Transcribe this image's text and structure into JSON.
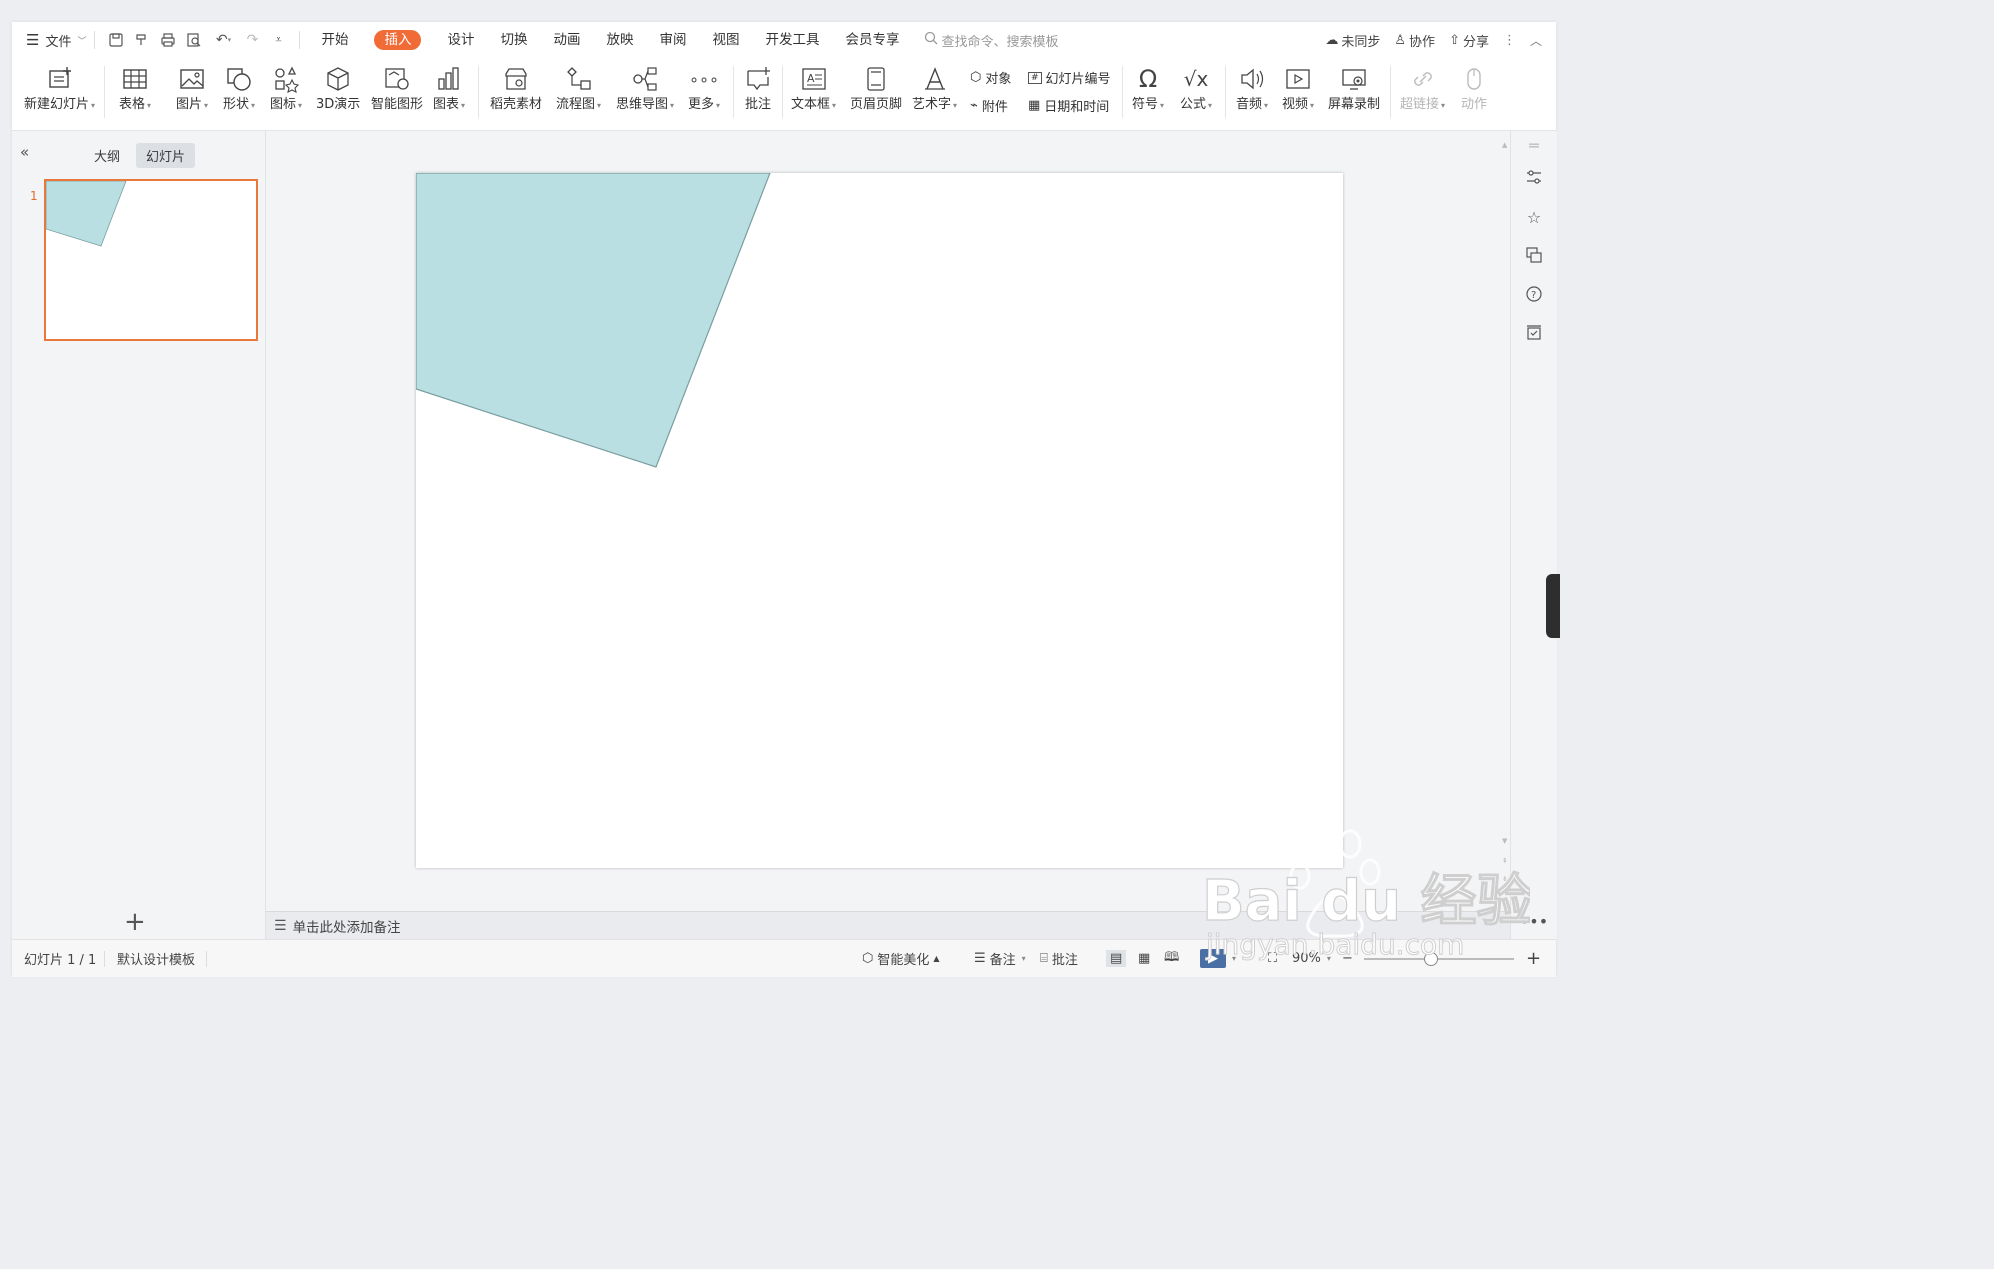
{
  "menubar": {
    "file_label": "文件",
    "tabs": [
      "开始",
      "插入",
      "设计",
      "切换",
      "动画",
      "放映",
      "审阅",
      "视图",
      "开发工具",
      "会员专享"
    ],
    "active_tab": "插入",
    "search_placeholder": "查找命令、搜索模板",
    "right": {
      "sync": "未同步",
      "collab": "协作",
      "share": "分享"
    }
  },
  "ribbon": {
    "new_slide": "新建幻灯片",
    "table": "表格",
    "picture": "图片",
    "shape": "形状",
    "icon": "图标",
    "demo3d": "3D演示",
    "smartart": "智能图形",
    "chart": "图表",
    "material": "稻壳素材",
    "flowchart": "流程图",
    "mindmap": "思维导图",
    "more": "更多",
    "comment": "批注",
    "textbox": "文本框",
    "header_footer": "页眉页脚",
    "wordart": "艺术字",
    "object": "对象",
    "slide_number": "幻灯片编号",
    "attachment": "附件",
    "datetime": "日期和时间",
    "symbol": "符号",
    "formula": "公式",
    "audio": "音频",
    "video": "视频",
    "screen_record": "屏幕录制",
    "hyperlink": "超链接",
    "action": "动作"
  },
  "left_panel": {
    "tab_outline": "大纲",
    "tab_slides": "幻灯片",
    "slide_number": "1"
  },
  "slide": {
    "shape_fill": "#b9dfe2",
    "shape_stroke": "#7a9ea0"
  },
  "notes_placeholder": "单击此处添加备注",
  "status": {
    "slide_info": "幻灯片 1 / 1",
    "template": "默认设计模板",
    "beautify": "智能美化",
    "notes": "备注",
    "comment": "批注",
    "zoom": "90%"
  },
  "watermark": {
    "brand": "Bai du 经验",
    "url": "jingyan.baidu.com"
  }
}
